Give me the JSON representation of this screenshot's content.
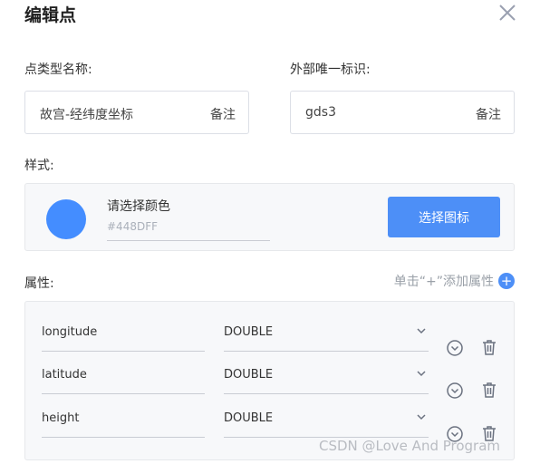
{
  "dialog": {
    "title": "编辑点"
  },
  "fields": {
    "type_name_label": "点类型名称:",
    "type_name_value": "故宫-经纬度坐标",
    "type_name_suffix": "备注",
    "uid_label": "外部唯一标识:",
    "uid_value": "gds3",
    "uid_suffix": "备注"
  },
  "style": {
    "label": "样式:",
    "color_title": "请选择颜色",
    "color_value": "#448DFF",
    "pick_icon_button": "选择图标"
  },
  "attributes": {
    "label": "属性:",
    "add_label": "单击“+”添加属性",
    "rows": [
      {
        "name": "longitude",
        "type": "DOUBLE"
      },
      {
        "name": "latitude",
        "type": "DOUBLE"
      },
      {
        "name": "height",
        "type": "DOUBLE"
      }
    ]
  },
  "watermark": "CSDN @Love And Program",
  "colors": {
    "accent": "#4d8ff7",
    "swatch": "#448DFF",
    "icon_gray": "#6b7280",
    "close_gray": "#9aa0b0"
  },
  "icons": {
    "close": "close-icon",
    "plus": "plus-icon",
    "chevron": "chevron-down-icon",
    "expand": "circle-chevron-down-icon",
    "delete": "trash-icon"
  }
}
